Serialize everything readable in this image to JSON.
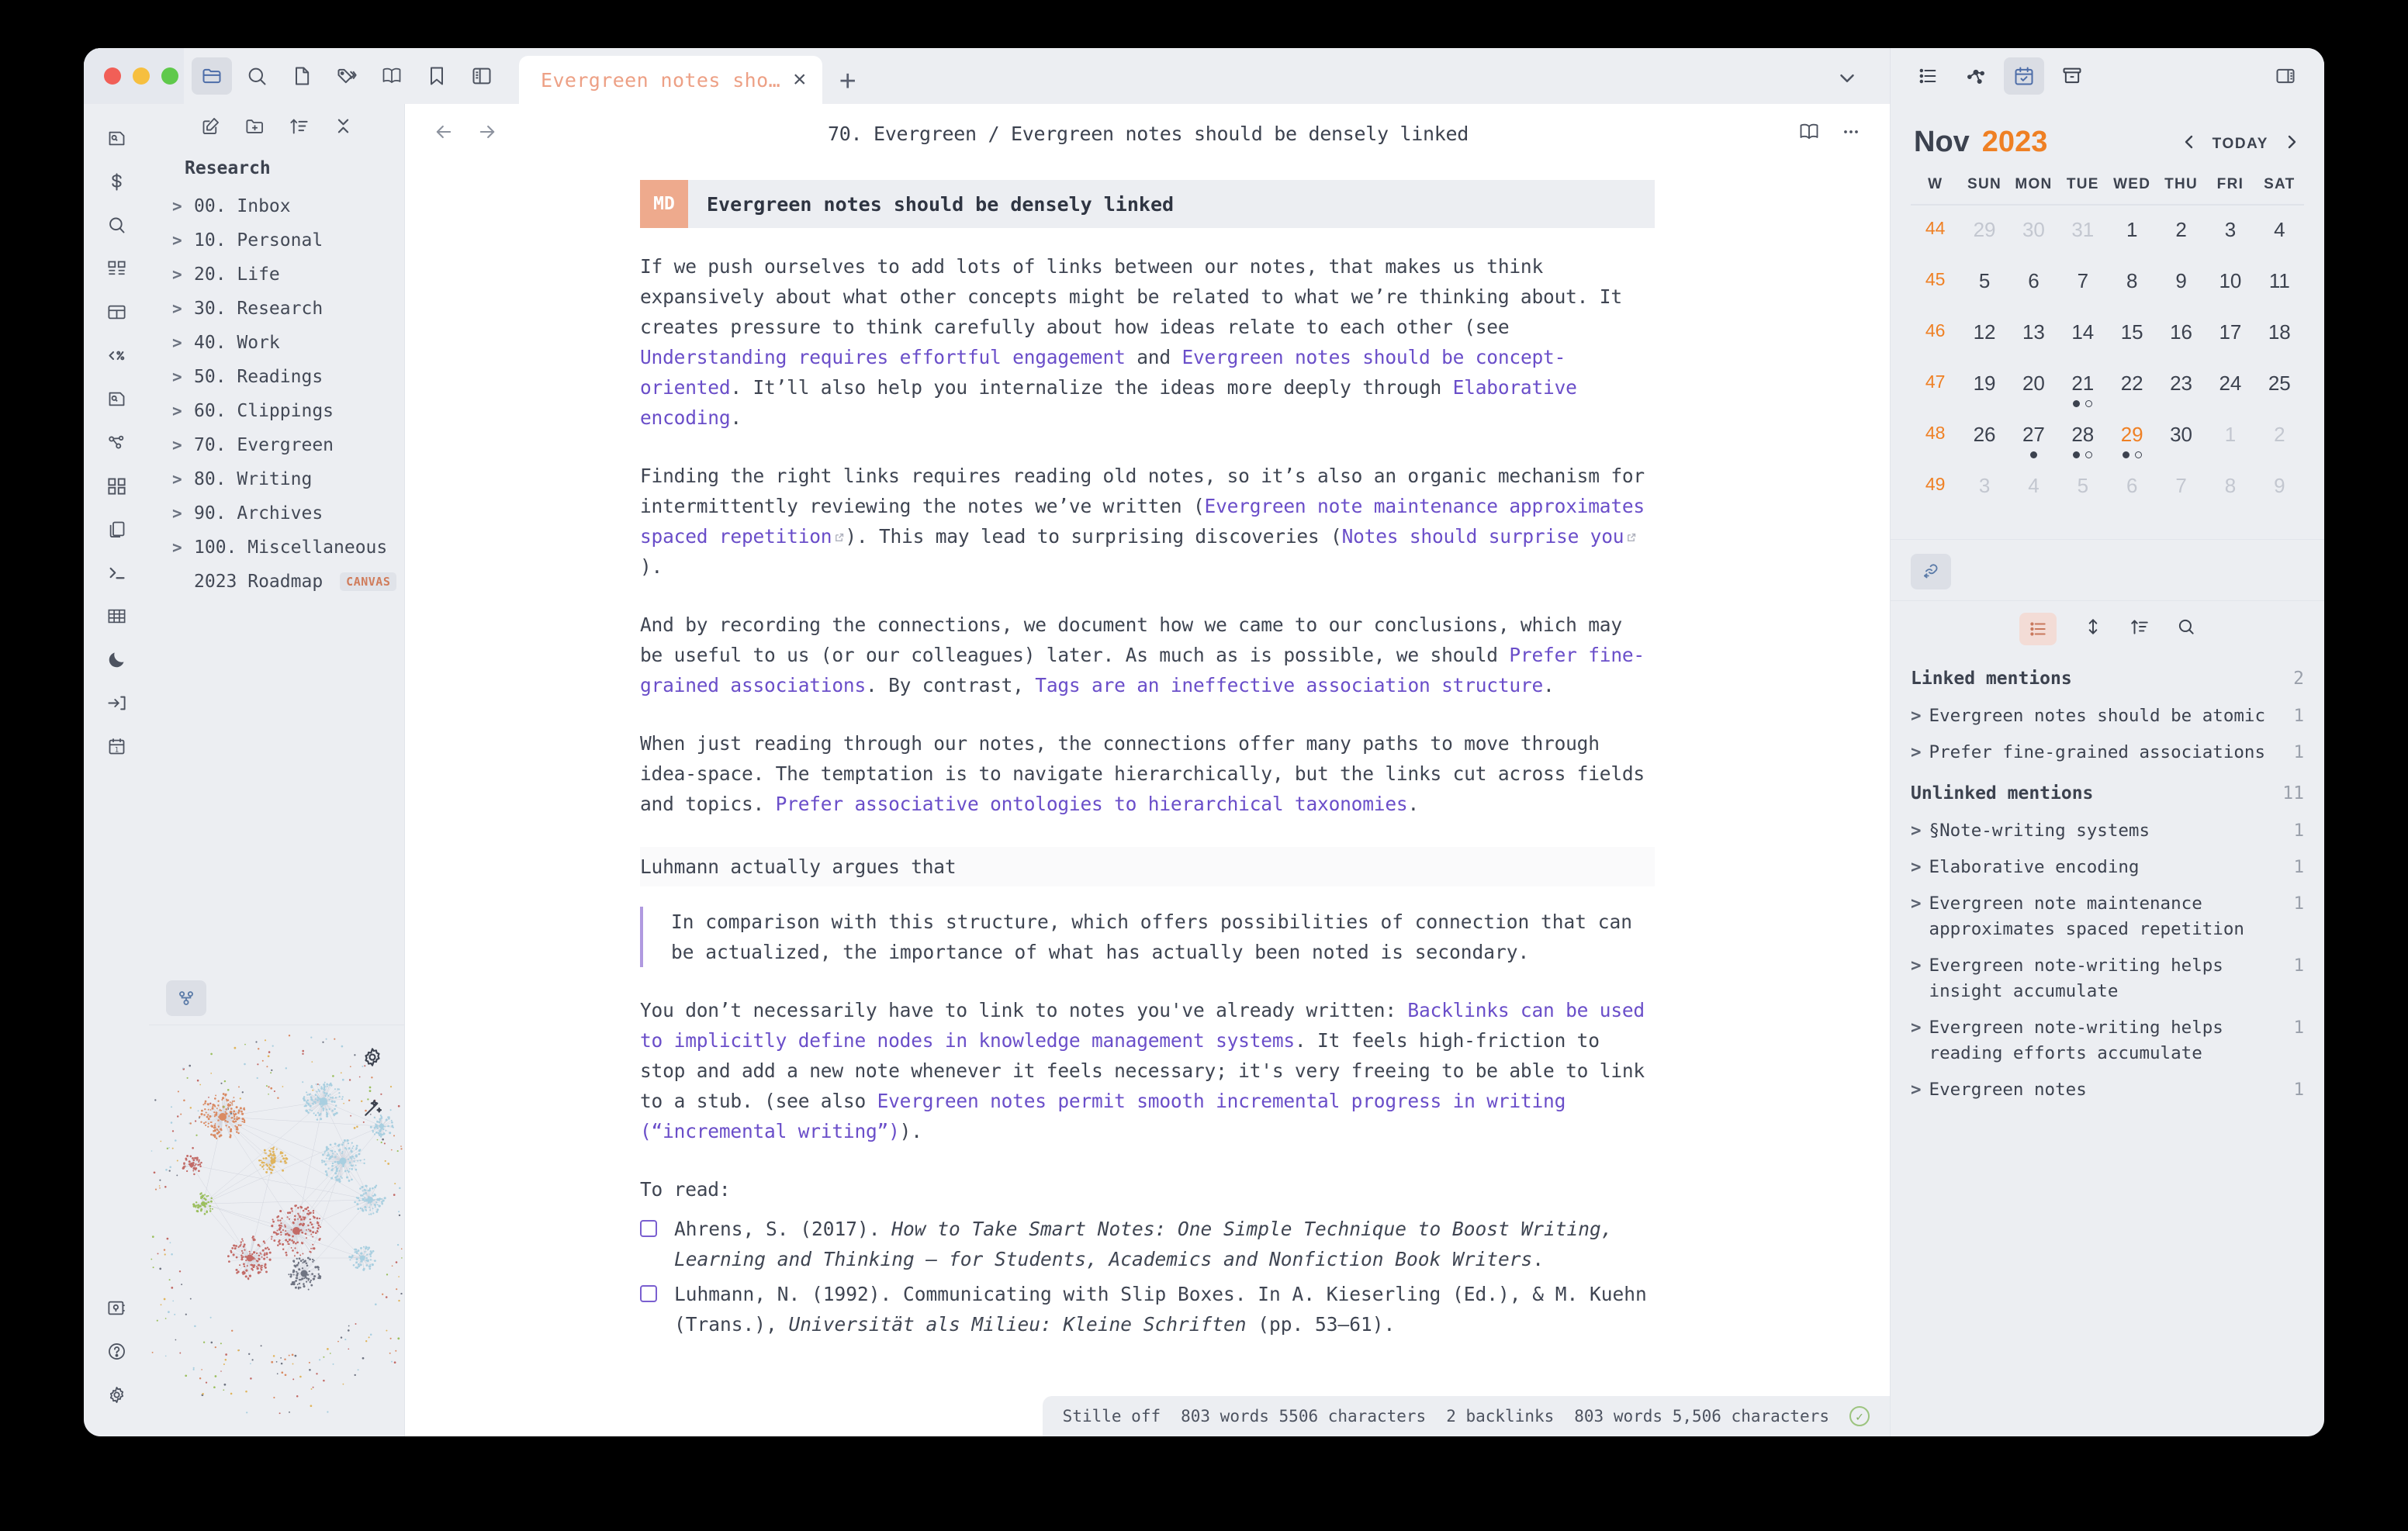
{
  "window": {
    "traffic_lights": [
      "close",
      "minimize",
      "zoom"
    ]
  },
  "topbar": {
    "icons": [
      {
        "name": "folder-icon",
        "active": true
      },
      {
        "name": "search-icon",
        "active": false
      },
      {
        "name": "file-icon",
        "active": false
      },
      {
        "name": "tags-icon",
        "active": false
      },
      {
        "name": "book-icon",
        "active": false
      },
      {
        "name": "bookmark-icon",
        "active": false
      },
      {
        "name": "sidebar-layout-icon",
        "active": false
      }
    ],
    "tab": {
      "title": "Evergreen notes sho…",
      "close_label": "×"
    },
    "new_tab_label": "+",
    "right_icons": [
      {
        "name": "list-icon",
        "active": false
      },
      {
        "name": "graph-icon",
        "active": false
      },
      {
        "name": "calendar-check-icon",
        "active": true
      },
      {
        "name": "archive-icon",
        "active": false
      },
      {
        "name": "right-panel-toggle-icon",
        "active": false
      }
    ]
  },
  "rail": {
    "items": [
      {
        "name": "file-search-icon"
      },
      {
        "name": "dollar-icon"
      },
      {
        "name": "search-icon"
      },
      {
        "name": "dashboard-icon"
      },
      {
        "name": "layout-icon"
      },
      {
        "name": "code-percent-icon"
      },
      {
        "name": "file-search-alt-icon"
      },
      {
        "name": "graph-icon"
      },
      {
        "name": "grid-icon"
      },
      {
        "name": "copy-icon"
      },
      {
        "name": "terminal-icon"
      },
      {
        "name": "table-icon"
      },
      {
        "name": "moon-icon"
      },
      {
        "name": "login-icon"
      },
      {
        "name": "calendar-day-icon"
      }
    ],
    "bottom_items": [
      {
        "name": "vault-icon"
      },
      {
        "name": "help-icon"
      },
      {
        "name": "settings-icon"
      }
    ]
  },
  "explorer": {
    "toolbar": [
      {
        "name": "new-note-icon"
      },
      {
        "name": "new-folder-icon"
      },
      {
        "name": "sort-icon"
      },
      {
        "name": "collapse-all-icon"
      }
    ],
    "title": "Research",
    "folders": [
      {
        "label": "00. Inbox"
      },
      {
        "label": "10. Personal"
      },
      {
        "label": "20. Life"
      },
      {
        "label": "30. Research"
      },
      {
        "label": "40. Work"
      },
      {
        "label": "50. Readings"
      },
      {
        "label": "60. Clippings"
      },
      {
        "label": "70. Evergreen"
      },
      {
        "label": "80. Writing"
      },
      {
        "label": "90. Archives"
      },
      {
        "label": "100. Miscellaneous"
      }
    ],
    "file": {
      "label": "2023 Roadmap",
      "badge": "CANVAS"
    }
  },
  "graph_panel": {
    "tab_icon": "graph-icon",
    "controls": [
      {
        "name": "graph-settings-icon"
      },
      {
        "name": "graph-magic-icon"
      }
    ]
  },
  "editor": {
    "back_icon": "arrow-left-icon",
    "forward_icon": "arrow-right-icon",
    "breadcrumb": "70. Evergreen / Evergreen notes should be densely linked",
    "header_icons": [
      {
        "name": "reading-view-icon"
      },
      {
        "name": "more-options-icon"
      }
    ],
    "note": {
      "badge": "MD",
      "title": "Evergreen notes should be densely linked"
    },
    "paragraphs": [
      {
        "id": "p1",
        "parts": [
          {
            "t": "text",
            "v": "If we push ourselves to add lots of links between our notes, that makes us think expansively about what other concepts might be related to what we’re thinking about. It creates pressure to think carefully about how ideas relate to each other (see "
          },
          {
            "t": "link",
            "v": "Understanding requires effortful engagement"
          },
          {
            "t": "text",
            "v": " and "
          },
          {
            "t": "link",
            "v": "Evergreen notes should be concept-oriented"
          },
          {
            "t": "text",
            "v": ". It’ll also help you internalize the ideas more deeply through "
          },
          {
            "t": "link",
            "v": "Elaborative encoding"
          },
          {
            "t": "text",
            "v": "."
          }
        ]
      },
      {
        "id": "p2",
        "parts": [
          {
            "t": "text",
            "v": "Finding the right links requires reading old notes, so it’s also an organic mechanism for intermittently reviewing the notes we’ve written ("
          },
          {
            "t": "link",
            "v": "Evergreen note maintenance approximates spaced repetition",
            "ext": true
          },
          {
            "t": "text",
            "v": "). This may lead to surprising discoveries ("
          },
          {
            "t": "link",
            "v": "Notes should surprise you",
            "ext": true
          },
          {
            "t": "text",
            "v": ")."
          }
        ]
      },
      {
        "id": "p3",
        "parts": [
          {
            "t": "text",
            "v": "And by recording the connections, we document how we came to our conclusions, which may be useful to us (or our colleagues) later. As much as is possible, we should "
          },
          {
            "t": "link",
            "v": "Prefer fine-grained associations"
          },
          {
            "t": "text",
            "v": ". By contrast, "
          },
          {
            "t": "link",
            "v": "Tags are an ineffective association structure"
          },
          {
            "t": "text",
            "v": "."
          }
        ]
      },
      {
        "id": "p4",
        "parts": [
          {
            "t": "text",
            "v": "When just reading through our notes, the connections offer many paths to move through idea-space. The temptation is to navigate hierarchically, but the links cut across fields and topics. "
          },
          {
            "t": "link",
            "v": "Prefer associative ontologies to hierarchical taxonomies"
          },
          {
            "t": "text",
            "v": "."
          }
        ]
      }
    ],
    "luhmann_line": "Luhmann actually argues that",
    "blockquote": "In comparison with this structure, which offers possibilities of connection that can be actualized, the importance of what has actually been noted is secondary.",
    "paragraph_after_quote": {
      "parts": [
        {
          "t": "text",
          "v": "You don’t necessarily have to link to notes you've already written: "
        },
        {
          "t": "link",
          "v": "Backlinks can be used to implicitly define nodes in knowledge management systems"
        },
        {
          "t": "text",
          "v": ". It feels high-friction to stop and add a new note whenever it feels necessary; it's very freeing to be able to link to a stub. (see also "
        },
        {
          "t": "link",
          "v": "Evergreen notes permit smooth incremental progress in writing (“incremental writing”)"
        },
        {
          "t": "text",
          "v": ")."
        }
      ]
    },
    "to_read_label": "To read:",
    "tasks": [
      {
        "checked": false,
        "parts": [
          {
            "t": "text",
            "v": "Ahrens, S. (2017). "
          },
          {
            "t": "em",
            "v": "How to Take Smart Notes: One Simple Technique to Boost Writing, Learning and Thinking — for Students, Academics and Nonfiction Book Writers"
          },
          {
            "t": "text",
            "v": "."
          }
        ]
      },
      {
        "checked": false,
        "parts": [
          {
            "t": "text",
            "v": "Luhmann, N. (1992). Communicating with Slip Boxes. In A. Kieserling (Ed.), & M. Kuehn (Trans.), "
          },
          {
            "t": "em",
            "v": "Universität als Milieu: Kleine Schriften"
          },
          {
            "t": "text",
            "v": " (pp. 53–61)."
          }
        ]
      }
    ]
  },
  "statusbar": {
    "items": [
      "Stille off",
      "803 words 5506 characters",
      "2 backlinks",
      "803 words 5,506 characters"
    ],
    "sync_icon": "sync-ok-icon"
  },
  "calendar": {
    "month": "Nov",
    "year": "2023",
    "prev_label": "‹",
    "today_label": "TODAY",
    "next_label": "›",
    "dow": [
      "W",
      "SUN",
      "MON",
      "TUE",
      "WED",
      "THU",
      "FRI",
      "SAT"
    ],
    "weeks": [
      {
        "w": "44",
        "days": [
          {
            "d": "29",
            "muted": true
          },
          {
            "d": "30",
            "muted": true
          },
          {
            "d": "31",
            "muted": true
          },
          {
            "d": "1"
          },
          {
            "d": "2"
          },
          {
            "d": "3"
          },
          {
            "d": "4"
          }
        ]
      },
      {
        "w": "45",
        "days": [
          {
            "d": "5"
          },
          {
            "d": "6"
          },
          {
            "d": "7"
          },
          {
            "d": "8"
          },
          {
            "d": "9"
          },
          {
            "d": "10"
          },
          {
            "d": "11"
          }
        ]
      },
      {
        "w": "46",
        "days": [
          {
            "d": "12"
          },
          {
            "d": "13"
          },
          {
            "d": "14"
          },
          {
            "d": "15"
          },
          {
            "d": "16"
          },
          {
            "d": "17"
          },
          {
            "d": "18"
          }
        ]
      },
      {
        "w": "47",
        "days": [
          {
            "d": "19"
          },
          {
            "d": "20"
          },
          {
            "d": "21",
            "dots": [
              "filled",
              "open"
            ]
          },
          {
            "d": "22"
          },
          {
            "d": "23"
          },
          {
            "d": "24"
          },
          {
            "d": "25"
          }
        ]
      },
      {
        "w": "48",
        "days": [
          {
            "d": "26"
          },
          {
            "d": "27",
            "dots": [
              "filled"
            ]
          },
          {
            "d": "28",
            "dots": [
              "filled",
              "open"
            ]
          },
          {
            "d": "29",
            "today": true,
            "dots": [
              "filled",
              "open"
            ]
          },
          {
            "d": "30"
          },
          {
            "d": "1",
            "muted": true
          },
          {
            "d": "2",
            "muted": true
          }
        ]
      },
      {
        "w": "49",
        "days": [
          {
            "d": "3",
            "muted": true
          },
          {
            "d": "4",
            "muted": true
          },
          {
            "d": "5",
            "muted": true
          },
          {
            "d": "6",
            "muted": true
          },
          {
            "d": "7",
            "muted": true
          },
          {
            "d": "8",
            "muted": true
          },
          {
            "d": "9",
            "muted": true
          }
        ]
      }
    ]
  },
  "backlinks": {
    "tab_icon": "backlink-icon",
    "toolbar": [
      {
        "name": "list-view-icon",
        "active": true
      },
      {
        "name": "expand-collapse-icon",
        "active": false
      },
      {
        "name": "sort-icon",
        "active": false
      },
      {
        "name": "search-icon",
        "active": false
      }
    ],
    "sections": [
      {
        "title": "Linked mentions",
        "count": "2",
        "items": [
          {
            "label": "Evergreen notes should be atomic",
            "count": "1"
          },
          {
            "label": "Prefer fine-grained associations",
            "count": "1"
          }
        ]
      },
      {
        "title": "Unlinked mentions",
        "count": "11",
        "items": [
          {
            "label": "§Note-writing systems",
            "count": "1"
          },
          {
            "label": "Elaborative encoding",
            "count": "1"
          },
          {
            "label": "Evergreen note maintenance approximates spaced repetition",
            "count": "1"
          },
          {
            "label": "Evergreen note-writing helps insight accumulate",
            "count": "1"
          },
          {
            "label": "Evergreen note-writing helps reading efforts accumulate",
            "count": "1"
          },
          {
            "label": "Evergreen notes",
            "count": "1"
          }
        ]
      }
    ]
  },
  "colors": {
    "accent_orange": "#ef8024",
    "tab_title": "#eda085",
    "link_purple": "#6a4ec9",
    "md_badge": "#eeaa8d",
    "panel_bg": "#eceef2",
    "editor_bg": "#ffffff"
  }
}
